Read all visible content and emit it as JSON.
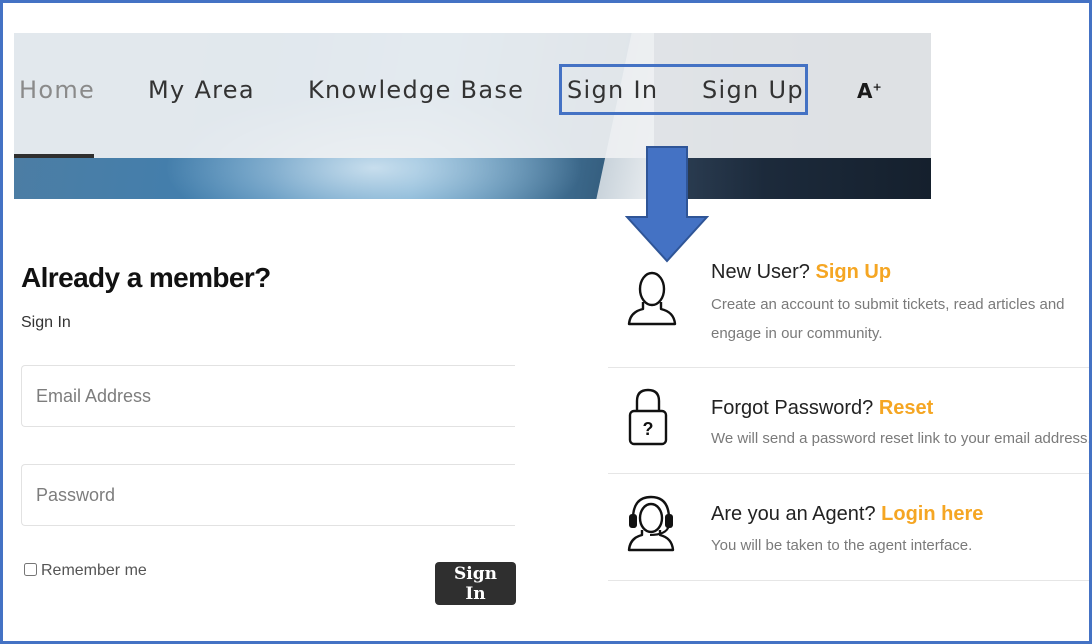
{
  "nav": {
    "items": [
      {
        "label": "Home"
      },
      {
        "label": "My Area"
      },
      {
        "label": "Knowledge Base"
      },
      {
        "label": "Sign In"
      },
      {
        "label": "Sign Up"
      }
    ],
    "text_size_label": "A",
    "text_size_sup": "+"
  },
  "signin_form": {
    "title": "Already a member?",
    "subtitle": "Sign In",
    "email_placeholder": "Email Address",
    "password_placeholder": "Password",
    "remember_label": "Remember me",
    "remember_checked": false,
    "submit_label": "Sign In"
  },
  "info": {
    "new_user": {
      "heading": "New User?",
      "link": "Sign Up",
      "description": "Create an account to submit tickets, read articles and engage in our community.",
      "icon": "user-icon"
    },
    "forgot_password": {
      "heading": "Forgot Password?",
      "link": "Reset",
      "description": "We will send a password reset link to your email address.",
      "icon": "lock-question-icon"
    },
    "agent": {
      "heading": "Are you an Agent?",
      "link": "Login here",
      "description": "You will be taken to the agent interface.",
      "icon": "headset-agent-icon"
    }
  },
  "colors": {
    "annotation_blue": "#4472c4",
    "link_orange": "#f5a623",
    "button_dark": "#2f2f2f"
  }
}
